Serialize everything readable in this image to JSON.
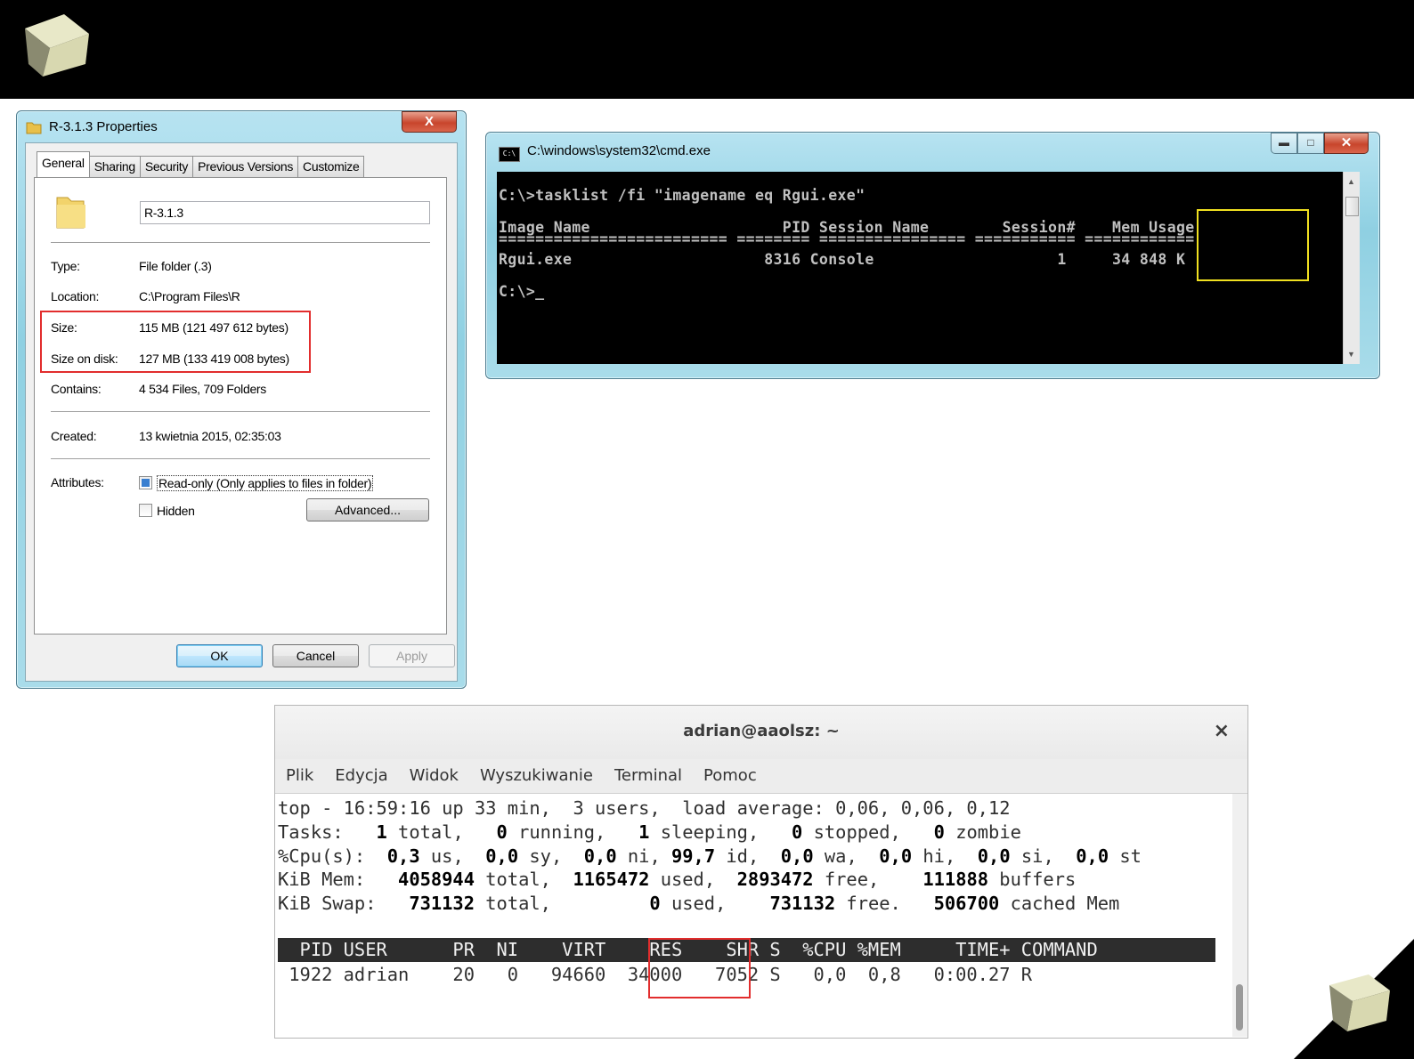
{
  "properties": {
    "title": "R-3.1.3 Properties",
    "close": "X",
    "tabs": [
      "General",
      "Sharing",
      "Security",
      "Previous Versions",
      "Customize"
    ],
    "name": "R-3.1.3",
    "fields": {
      "type_label": "Type:",
      "type_value": "File folder (.3)",
      "location_label": "Location:",
      "location_value": "C:\\Program Files\\R",
      "size_label": "Size:",
      "size_value": "115 MB (121 497 612 bytes)",
      "size_on_disk_label": "Size on disk:",
      "size_on_disk_value": "127 MB (133 419 008 bytes)",
      "contains_label": "Contains:",
      "contains_value": "4 534 Files, 709 Folders",
      "created_label": "Created:",
      "created_value": "13 kwietnia 2015, 02:35:03",
      "attributes_label": "Attributes:"
    },
    "readonly_label": "Read-only (Only applies to files in folder)",
    "hidden_label": "Hidden",
    "advanced_label": "Advanced...",
    "ok_label": "OK",
    "cancel_label": "Cancel",
    "apply_label": "Apply"
  },
  "cmd": {
    "title": "C:\\windows\\system32\\cmd.exe",
    "icon_text": "C:\\",
    "lines": [
      "C:\\>tasklist /fi \"imagename eq Rgui.exe\"",
      "Image Name                     PID Session Name        Session#    Mem Usage",
      "========================= ======== ================ =========== ============",
      "Rgui.exe                     8316 Console                    1     34 848 K",
      "C:\\>_"
    ]
  },
  "terminal": {
    "title": "adrian@aaolsz: ~",
    "close": "×",
    "menu": [
      "Plik",
      "Edycja",
      "Widok",
      "Wyszukiwanie",
      "Terminal",
      "Pomoc"
    ],
    "line1": "top - 16:59:16 up 33 min,  3 users,  load average: 0,06, 0,06, 0,12",
    "tasks": [
      "Tasks: ",
      "  1",
      " total, ",
      "  0",
      " running, ",
      "  1",
      " sleeping, ",
      "  0",
      " stopped, ",
      "  0",
      " zombie"
    ],
    "cpu": [
      "%Cpu(s): ",
      " 0,3",
      " us, ",
      " 0,0",
      " sy, ",
      " 0,0",
      " ni, ",
      "99,7",
      " id, ",
      " 0,0",
      " wa, ",
      " 0,0",
      " hi, ",
      " 0,0",
      " si, ",
      " 0,0",
      " st"
    ],
    "mem": [
      "KiB Mem: ",
      "  4058944",
      " total, ",
      " 1165472",
      " used, ",
      " 2893472",
      " free, ",
      "   111888",
      " buffers"
    ],
    "swap": [
      "KiB Swap: ",
      "  731132",
      " total, ",
      "        0",
      " used, ",
      "   731132",
      " free. ",
      "  506700",
      " cached Mem"
    ],
    "header": "  PID USER      PR  NI    VIRT    RES    SHR S  %CPU %MEM     TIME+ COMMAND",
    "row": " 1922 adrian    20   0   94660  34000   7052 S   0,0  0,8   0:00.27 R"
  }
}
